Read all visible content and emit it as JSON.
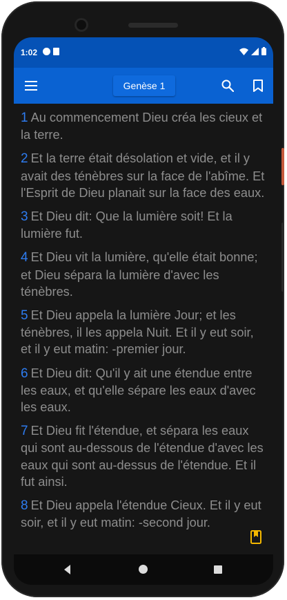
{
  "status_bar": {
    "time": "1:02",
    "icons": [
      "play-protect-icon",
      "sd-card-icon",
      "wifi-icon",
      "signal-icon",
      "battery-icon"
    ]
  },
  "app_bar": {
    "menu_icon": "hamburger-menu-icon",
    "title": "Genèse 1",
    "search_icon": "search-icon",
    "bookmark_icon": "bookmark-icon"
  },
  "verses": [
    {
      "num": "1",
      "text": "Au commencement Dieu créa les cieux et la terre."
    },
    {
      "num": "2",
      "text": "Et la terre était désolation et vide, et il y avait des ténèbres sur la face de l'abîme. Et l'Esprit de Dieu planait sur la face des eaux."
    },
    {
      "num": "3",
      "text": "Et Dieu dit: Que la lumière soit! Et la lumière fut."
    },
    {
      "num": "4",
      "text": "Et Dieu vit la lumière, qu'elle était bonne; et Dieu sépara la lumière d'avec les ténèbres."
    },
    {
      "num": "5",
      "text": "Et Dieu appela la lumière Jour; et les ténèbres, il les appela Nuit. Et il y eut soir, et il y eut matin: -premier jour."
    },
    {
      "num": "6",
      "text": "Et Dieu dit: Qu'il y ait une étendue entre les eaux, et qu'elle sépare les eaux d'avec les eaux."
    },
    {
      "num": "7",
      "text": "Et Dieu fit l'étendue, et sépara les eaux qui sont au-dessous de l'étendue d'avec les eaux qui sont au-dessus de l'étendue. Et il fut ainsi."
    },
    {
      "num": "8",
      "text": "Et Dieu appela l'étendue Cieux. Et il y eut soir, et il y eut matin: -second jour."
    }
  ],
  "floating_bookmark_icon": "bookmark-filled-icon",
  "nav_bar": {
    "back_icon": "back-triangle-icon",
    "home_icon": "home-circle-icon",
    "recents_icon": "recents-square-icon"
  },
  "colors": {
    "status_bar": "#0552b6",
    "app_bar": "#0a62d2",
    "background": "#161616",
    "verse_text": "#8d8d8d",
    "verse_number": "#2e7cf0",
    "floating_bookmark": "#f5b800"
  }
}
